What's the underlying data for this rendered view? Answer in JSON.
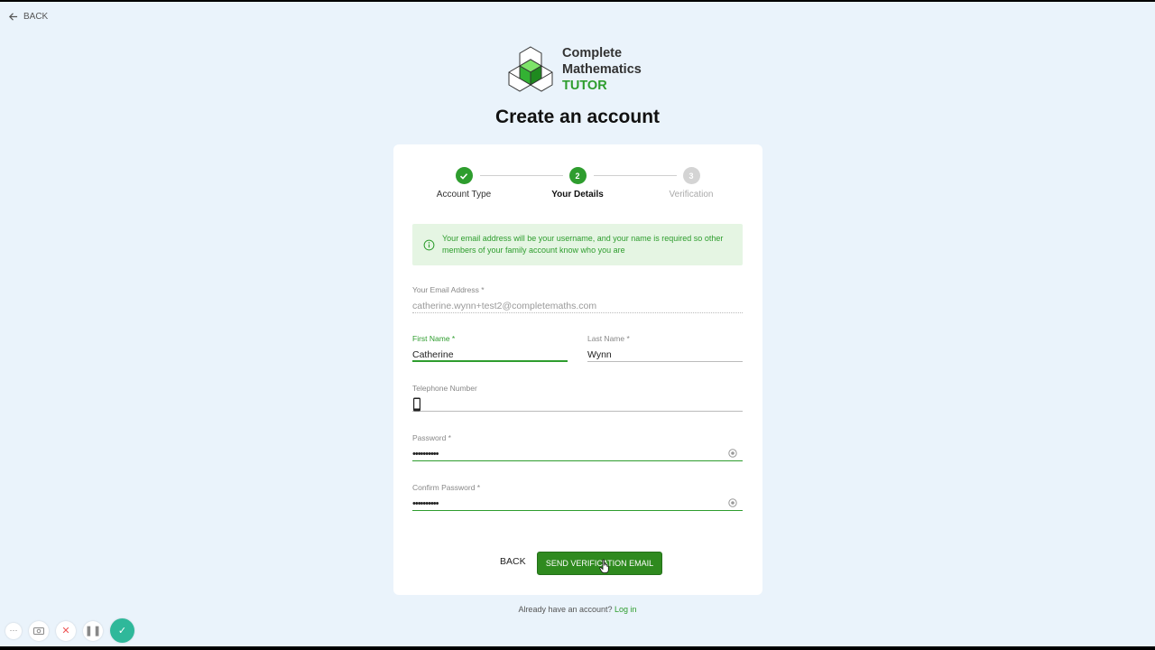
{
  "nav": {
    "back_label": "BACK"
  },
  "logo": {
    "line1": "Complete",
    "line2": "Mathematics",
    "line3": "TUTOR"
  },
  "page_title": "Create an account",
  "stepper": {
    "steps": [
      {
        "number": "1",
        "label": "Account Type",
        "state": "done"
      },
      {
        "number": "2",
        "label": "Your Details",
        "state": "active"
      },
      {
        "number": "3",
        "label": "Verification",
        "state": "todo"
      }
    ]
  },
  "info": {
    "text": "Your email address will be your username, and your name is required so other members of your family account know who you are"
  },
  "form": {
    "email": {
      "label": "Your Email Address *",
      "value": "catherine.wynn+test2@completemaths.com"
    },
    "first_name": {
      "label": "First Name *",
      "value": "Catherine"
    },
    "last_name": {
      "label": "Last Name *",
      "value": "Wynn"
    },
    "phone": {
      "label": "Telephone Number",
      "value": ""
    },
    "password": {
      "label": "Password *",
      "value": "••••••••••"
    },
    "confirm_password": {
      "label": "Confirm Password *",
      "value": "••••••••••"
    }
  },
  "actions": {
    "back_label": "BACK",
    "send_label": "SEND VERIFICATION EMAIL"
  },
  "footer": {
    "prompt": "Already have an account?",
    "login_label": "Log in"
  },
  "colors": {
    "accent": "#2e9d2e",
    "button": "#2f8a1f",
    "background": "#eaf3fb"
  }
}
